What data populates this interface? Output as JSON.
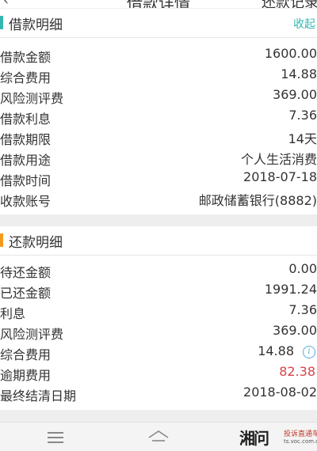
{
  "colors": {
    "loan_bar": "#35b6b0",
    "repay_bar": "#f39a1e",
    "link": "#35b6b0",
    "overdue": "#d9434a"
  },
  "header": {
    "back_icon": "chevron-left-icon",
    "title": "借款详情",
    "right_label": "还款记录"
  },
  "loan": {
    "title": "借款明细",
    "collapse_label": "收起",
    "rows": [
      {
        "label": "借款金额",
        "value": "1600.00"
      },
      {
        "label": "综合费用",
        "value": "14.88"
      },
      {
        "label": "风险测评费",
        "value": "369.00"
      },
      {
        "label": "借款利息",
        "value": "7.36"
      },
      {
        "label": "借款期限",
        "value": "14天"
      },
      {
        "label": "借款用途",
        "value": "个人生活消费"
      },
      {
        "label": "借款时间",
        "value": "2018-07-18"
      },
      {
        "label": "收款账号",
        "value": "邮政储蓄银行(8882)"
      }
    ]
  },
  "repay": {
    "title": "还款明细",
    "rows": [
      {
        "label": "待还金额",
        "value": "0.00"
      },
      {
        "label": "已还金额",
        "value": "1991.24"
      },
      {
        "label": "利息",
        "value": "7.36"
      },
      {
        "label": "风险测评费",
        "value": "369.00"
      },
      {
        "label": "综合费用",
        "value": "14.88",
        "icon": "info-icon"
      },
      {
        "label": "逾期费用",
        "value": "82.38"
      },
      {
        "label": "最终结清日期",
        "value": "2018-08-02"
      }
    ]
  },
  "navbar": {
    "menu_icon": "menu-icon",
    "home_icon": "home-icon"
  },
  "watermark": {
    "logo": "湘问",
    "text": "投诉直通车",
    "url": "ts.voc.com.cn"
  }
}
